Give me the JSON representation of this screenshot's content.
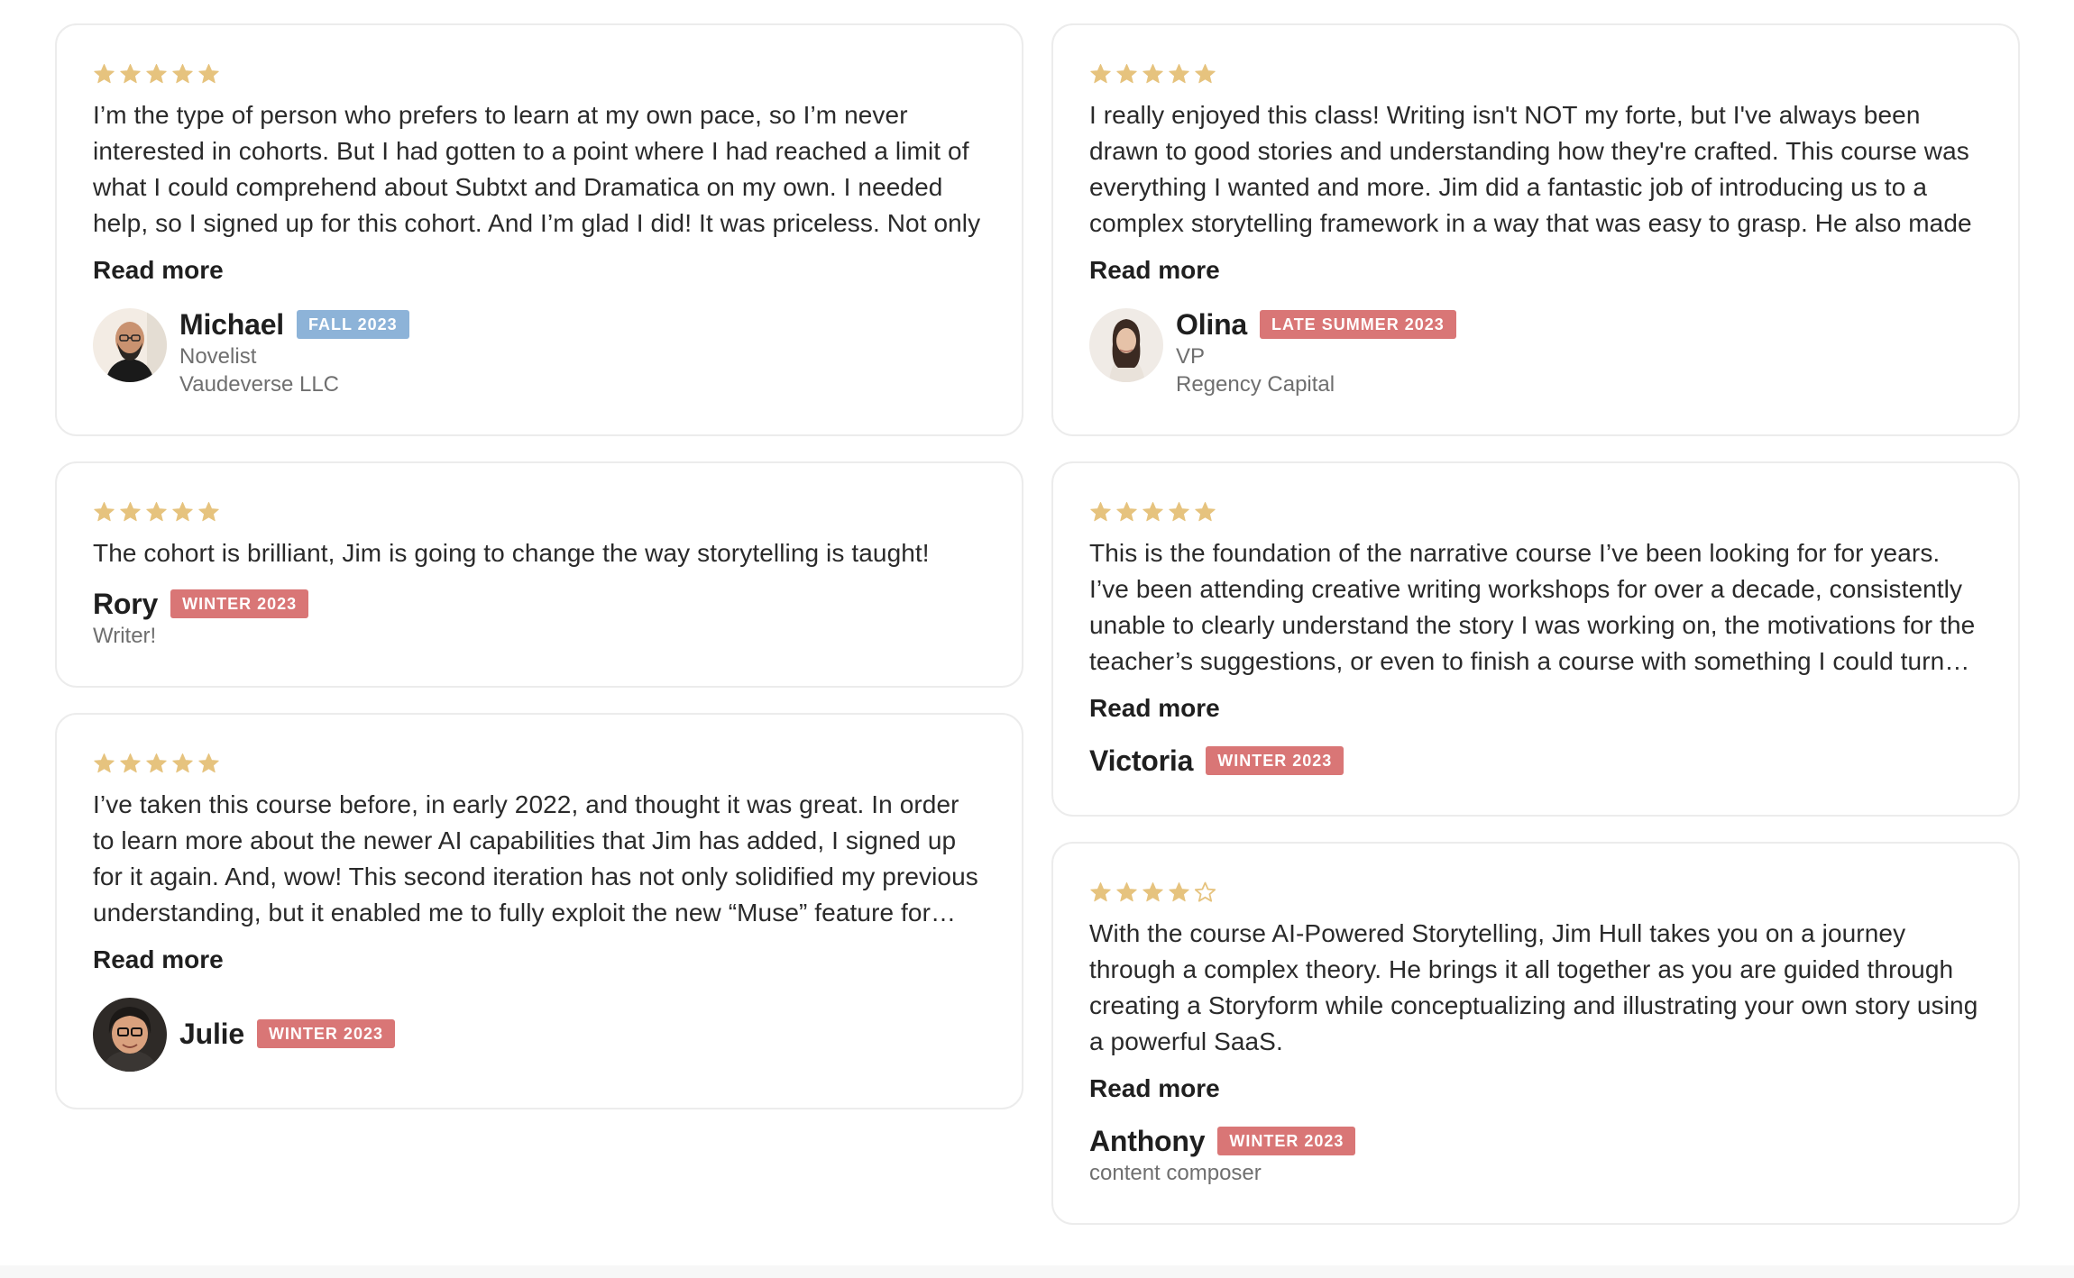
{
  "colors": {
    "star_filled": "#e6c37e",
    "badge_winter": "#d97676",
    "badge_fall": "#8db3d8",
    "card_border": "#ececec"
  },
  "reviews": [
    {
      "rating": 5,
      "text": "I’m the type of person who prefers to learn at my own pace, so I’m never interested in cohorts. But I had gotten to a point where I had reached a limit of what I could comprehend about Subtxt and Dramatica on my own. I needed help, so I signed up for this cohort. And I’m glad I did! It was priceless. Not only",
      "read_more": "Read more",
      "name": "Michael",
      "cohort": "FALL 2023",
      "role": "Novelist",
      "company": "Vaudeverse LLC"
    },
    {
      "rating": 5,
      "text": "I really enjoyed this class! Writing isn't NOT my forte, but I've always been drawn to good stories and understanding how they're crafted. This course was everything I wanted and more. Jim did a fantastic job of introducing us to a complex storytelling framework in a way that was easy to grasp. He also made",
      "read_more": "Read more",
      "name": "Olina",
      "cohort": "LATE SUMMER 2023",
      "role": "VP",
      "company": "Regency Capital"
    },
    {
      "rating": 5,
      "text": "The cohort is brilliant, Jim is going to change the way storytelling is taught!",
      "name": "Rory",
      "cohort": "WINTER 2023",
      "role": "Writer!"
    },
    {
      "rating": 5,
      "text": "This is the foundation of the narrative course I’ve been looking for for years. I’ve been attending creative writing workshops for over a decade, consistently unable to clearly understand the story I was working on, the motivations for the teacher’s suggestions, or even to finish a course with something I could turn into a story",
      "read_more": "Read more",
      "name": "Victoria",
      "cohort": "WINTER 2023"
    },
    {
      "rating": 5,
      "text": "I’ve taken this course before, in early 2022, and thought it was great. In order to learn more about the newer AI capabilities that Jim has added, I signed up for it again. And, wow! This second iteration has not only solidified my previous understanding, but it enabled me to fully exploit the new “Muse” feature for brainstorming",
      "read_more": "Read more",
      "name": "Julie",
      "cohort": "WINTER 2023"
    },
    {
      "rating": 4,
      "text": "With the course AI-Powered Storytelling, Jim Hull takes you on a journey through a complex theory. He brings it all together as you are guided through creating a Storyform while conceptualizing and illustrating your own story using a powerful SaaS.",
      "read_more": "Read more",
      "name": "Anthony",
      "cohort": "WINTER 2023",
      "role": "content composer"
    }
  ]
}
